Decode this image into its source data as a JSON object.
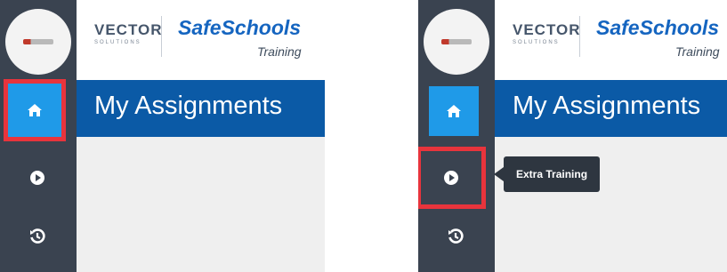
{
  "header": {
    "vector_logo_text": "VECTOR",
    "vector_logo_subtext": "SOLUTIONS",
    "brand_name": "SafeSchools",
    "brand_subtitle": "Training"
  },
  "page_title": "My Assignments",
  "sidebar": {
    "items": [
      {
        "icon": "home-icon",
        "state": "active"
      },
      {
        "icon": "play-circle-icon",
        "state": "normal"
      },
      {
        "icon": "history-icon",
        "state": "normal"
      }
    ]
  },
  "tooltip": {
    "text": "Extra Training"
  },
  "colors": {
    "sidebar_bg": "#3a4350",
    "active_blue": "#1f9ae8",
    "title_bar": "#0b5aa6",
    "highlight_red": "#e8343c",
    "brand_blue": "#1565c0"
  }
}
